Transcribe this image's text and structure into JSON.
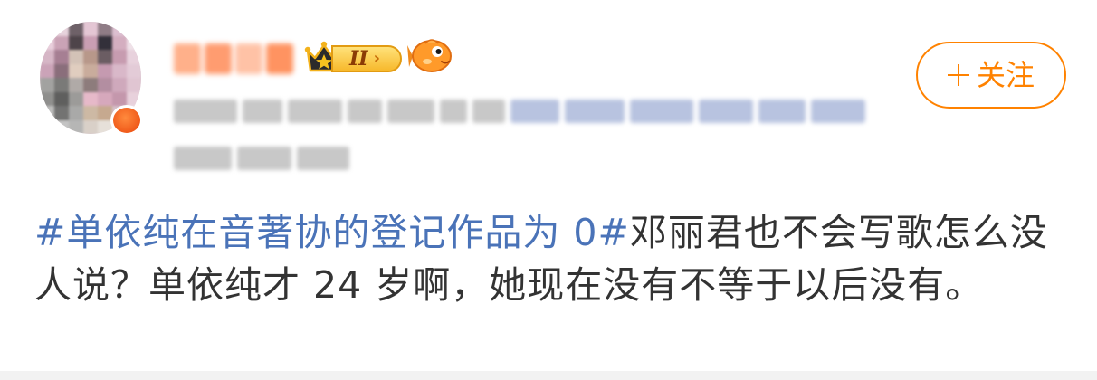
{
  "post": {
    "username": "",
    "level": "II",
    "follow_label": "关注",
    "topic": "#单依纯在音著协的登记作品为 0#",
    "body": "邓丽君也不会写歌怎么没人说？单依纯才 24 岁啊，她现在没有不等于以后没有。"
  },
  "icons": {
    "avatar": "avatar-image",
    "crown": "crown-icon",
    "fish": "fish-emoji-icon",
    "plus": "plus-icon"
  },
  "colors": {
    "accent": "#ff8200",
    "topic": "#4a73b8",
    "text": "#333333"
  }
}
